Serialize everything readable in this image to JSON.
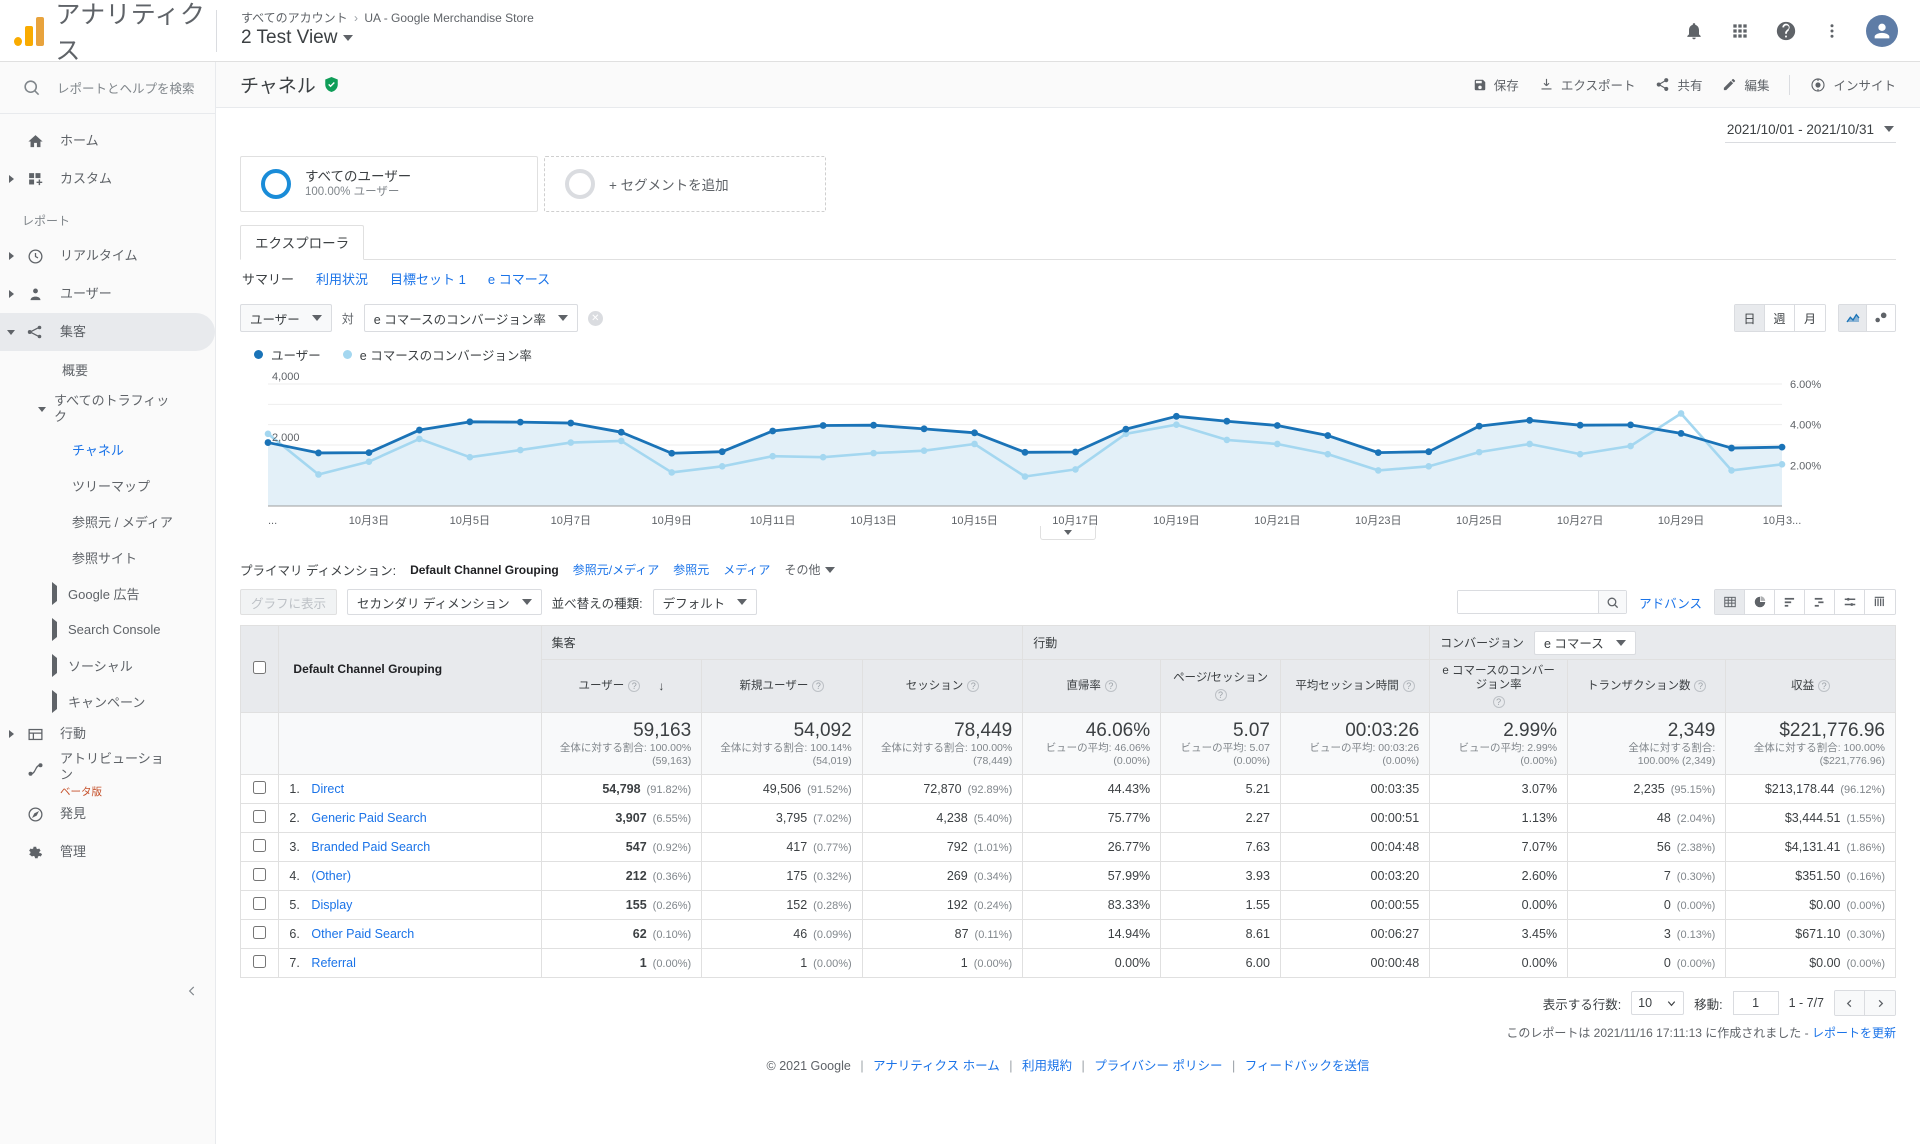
{
  "topbar": {
    "brand": "アナリティクス",
    "breadcrumb_account": "すべてのアカウント",
    "breadcrumb_sep": "›",
    "breadcrumb_property": "UA - Google Merchandise Store",
    "view_name": "2 Test View"
  },
  "sidebar": {
    "search_placeholder": "レポートとヘルプを検索",
    "items": [
      {
        "label": "ホーム",
        "icon": "home-icon"
      },
      {
        "label": "カスタム",
        "icon": "custom-icon"
      }
    ],
    "section_label": "レポート",
    "reports": [
      {
        "label": "リアルタイム",
        "icon": "clock-icon"
      },
      {
        "label": "ユーザー",
        "icon": "person-icon"
      },
      {
        "label": "集客",
        "icon": "acquisition-icon"
      }
    ],
    "acquisition_children": [
      {
        "label": "概要"
      },
      {
        "label": "すべてのトラフィック"
      },
      {
        "label": "チャネル"
      },
      {
        "label": "ツリーマップ"
      },
      {
        "label": "参照元 / メディア"
      },
      {
        "label": "参照サイト"
      },
      {
        "label": "Google 広告"
      },
      {
        "label": "Search Console"
      },
      {
        "label": "ソーシャル"
      },
      {
        "label": "キャンペーン"
      }
    ],
    "bottom": [
      {
        "label": "行動",
        "icon": "behavior-icon"
      },
      {
        "label": "アトリビューション",
        "icon": "attribution-icon",
        "badge": "ベータ版"
      },
      {
        "label": "発見",
        "icon": "discover-icon"
      },
      {
        "label": "管理",
        "icon": "gear-icon"
      }
    ]
  },
  "report": {
    "title": "チャネル",
    "actions": [
      {
        "label": "保存",
        "icon": "save-icon"
      },
      {
        "label": "エクスポート",
        "icon": "export-icon"
      },
      {
        "label": "共有",
        "icon": "share-icon"
      },
      {
        "label": "編集",
        "icon": "edit-icon"
      },
      {
        "label": "インサイト",
        "icon": "insights-icon"
      }
    ],
    "date_range": "2021/10/01 - 2021/10/31"
  },
  "segments": {
    "primary_title": "すべてのユーザー",
    "primary_sub": "100.00% ユーザー",
    "add_label": "+ セグメントを追加"
  },
  "tabs": {
    "explorer": "エクスプローラ",
    "subtabs": [
      {
        "label": "サマリー",
        "active": true
      },
      {
        "label": "利用状況",
        "active": false
      },
      {
        "label": "目標セット 1",
        "active": false
      },
      {
        "label": "e コマース",
        "active": false
      }
    ]
  },
  "metric_controls": {
    "metric1": "ユーザー",
    "vs_label": "対",
    "metric2": "e コマースのコンバージョン率",
    "granularity": [
      {
        "label": "日",
        "active": true
      },
      {
        "label": "週",
        "active": false
      },
      {
        "label": "月",
        "active": false
      }
    ]
  },
  "chart_data": {
    "type": "line",
    "title": "",
    "legend": [
      {
        "name": "ユーザー",
        "color": "#1a73b7"
      },
      {
        "name": "e コマースのコンバージョン率",
        "color": "#a4d7f0"
      }
    ],
    "legend_position": "top-left",
    "grid": true,
    "x": [
      "10月1日",
      "10月2日",
      "10月3日",
      "10月4日",
      "10月5日",
      "10月6日",
      "10月7日",
      "10月8日",
      "10月9日",
      "10月10日",
      "10月11日",
      "10月12日",
      "10月13日",
      "10月14日",
      "10月15日",
      "10月16日",
      "10月17日",
      "10月18日",
      "10月19日",
      "10月20日",
      "10月21日",
      "10月22日",
      "10月23日",
      "10月24日",
      "10月25日",
      "10月26日",
      "10月27日",
      "10月28日",
      "10月29日",
      "10月30日",
      "10月31日"
    ],
    "xtick_labels": [
      "...",
      "10月3日",
      "10月5日",
      "10月7日",
      "10月9日",
      "10月11日",
      "10月13日",
      "10月15日",
      "10月17日",
      "10月19日",
      "10月21日",
      "10月23日",
      "10月25日",
      "10月27日",
      "10月29日",
      "10月3..."
    ],
    "xlabel": "",
    "ylabel": "ユーザー",
    "ylim": [
      0,
      4000
    ],
    "ytick_labels_left": [
      "4,000",
      "2,000"
    ],
    "y2label": "e コマースのコンバージョン率",
    "y2lim": [
      0,
      6
    ],
    "ytick_labels_right": [
      "6.00%",
      "4.00%",
      "2.00%"
    ],
    "series": [
      {
        "name": "ユーザー",
        "color": "#1a73b7",
        "values": [
          2080,
          1740,
          1750,
          2490,
          2760,
          2750,
          2720,
          2420,
          1730,
          1780,
          2460,
          2640,
          2650,
          2530,
          2400,
          1760,
          1770,
          2520,
          2940,
          2780,
          2640,
          2310,
          1750,
          1780,
          2620,
          2810,
          2650,
          2660,
          2380,
          1900,
          1930
        ]
      },
      {
        "name": "e コマースのコンバージョン率",
        "color": "#a4d7f0",
        "values": [
          3.55,
          1.55,
          2.18,
          3.3,
          2.4,
          2.75,
          3.12,
          3.2,
          1.65,
          1.95,
          2.45,
          2.4,
          2.6,
          2.72,
          3.05,
          1.45,
          1.8,
          3.55,
          4.0,
          3.25,
          3.05,
          2.55,
          1.75,
          1.95,
          2.65,
          3.05,
          2.55,
          2.95,
          4.55,
          1.75,
          2.05
        ]
      }
    ]
  },
  "dimension_bar": {
    "label": "プライマリ ディメンション:",
    "current": "Default Channel Grouping",
    "links": [
      "参照元/メディア",
      "参照元",
      "メディア"
    ],
    "more": "その他"
  },
  "toolbar": {
    "plot_rows": "グラフに表示",
    "secondary_dimension": "セカンダリ ディメンション",
    "sort_type_label": "並べ替えの種類:",
    "sort_type_value": "デフォルト",
    "search_value": "",
    "advanced": "アドバンス",
    "view_icons": [
      "table-view-icon",
      "pie-view-icon",
      "bar-view-icon",
      "comparison-view-icon",
      "pivot-view-icon",
      "performance-view-icon"
    ]
  },
  "table": {
    "groups": [
      {
        "label": "集客",
        "span": 3
      },
      {
        "label": "行動",
        "span": 3
      },
      {
        "label": "コンバージョン",
        "span": 3,
        "select": "e コマース"
      }
    ],
    "dimension_header": "Default Channel Grouping",
    "metric_headers": [
      {
        "label": "ユーザー",
        "sorted": true
      },
      {
        "label": "新規ユーザー",
        "sorted": false
      },
      {
        "label": "セッション",
        "sorted": false
      },
      {
        "label": "直帰率",
        "sorted": false
      },
      {
        "label": "ページ/セッション",
        "sorted": false
      },
      {
        "label": "平均セッション時間",
        "sorted": false
      },
      {
        "label": "e コマースのコンバージョン率",
        "sorted": false
      },
      {
        "label": "トランザクション数",
        "sorted": false
      },
      {
        "label": "収益",
        "sorted": false
      }
    ],
    "summary": [
      {
        "value": "59,163",
        "sub1": "全体に対する割合: 100.00%",
        "sub2": "(59,163)"
      },
      {
        "value": "54,092",
        "sub1": "全体に対する割合: 100.14%",
        "sub2": "(54,019)"
      },
      {
        "value": "78,449",
        "sub1": "全体に対する割合: 100.00%",
        "sub2": "(78,449)"
      },
      {
        "value": "46.06%",
        "sub1": "ビューの平均: 46.06%",
        "sub2": "(0.00%)"
      },
      {
        "value": "5.07",
        "sub1": "ビューの平均: 5.07",
        "sub2": "(0.00%)"
      },
      {
        "value": "00:03:26",
        "sub1": "ビューの平均: 00:03:26",
        "sub2": "(0.00%)"
      },
      {
        "value": "2.99%",
        "sub1": "ビューの平均: 2.99%",
        "sub2": "(0.00%)"
      },
      {
        "value": "2,349",
        "sub1": "全体に対する割合:",
        "sub2": "100.00% (2,349)"
      },
      {
        "value": "$221,776.96",
        "sub1": "全体に対する割合: 100.00%",
        "sub2": "($221,776.96)"
      }
    ],
    "rows": [
      {
        "index": "1.",
        "name": "Direct",
        "cells": [
          {
            "v": "54,798",
            "p": "(91.82%)",
            "bold": true
          },
          {
            "v": "49,506",
            "p": "(91.52%)"
          },
          {
            "v": "72,870",
            "p": "(92.89%)"
          },
          {
            "v": "44.43%",
            "p": ""
          },
          {
            "v": "5.21",
            "p": ""
          },
          {
            "v": "00:03:35",
            "p": ""
          },
          {
            "v": "3.07%",
            "p": ""
          },
          {
            "v": "2,235",
            "p": "(95.15%)"
          },
          {
            "v": "$213,178.44",
            "p": "(96.12%)"
          }
        ]
      },
      {
        "index": "2.",
        "name": "Generic Paid Search",
        "cells": [
          {
            "v": "3,907",
            "p": "(6.55%)",
            "bold": true
          },
          {
            "v": "3,795",
            "p": "(7.02%)"
          },
          {
            "v": "4,238",
            "p": "(5.40%)"
          },
          {
            "v": "75.77%",
            "p": ""
          },
          {
            "v": "2.27",
            "p": ""
          },
          {
            "v": "00:00:51",
            "p": ""
          },
          {
            "v": "1.13%",
            "p": ""
          },
          {
            "v": "48",
            "p": "(2.04%)"
          },
          {
            "v": "$3,444.51",
            "p": "(1.55%)"
          }
        ]
      },
      {
        "index": "3.",
        "name": "Branded Paid Search",
        "cells": [
          {
            "v": "547",
            "p": "(0.92%)",
            "bold": true
          },
          {
            "v": "417",
            "p": "(0.77%)"
          },
          {
            "v": "792",
            "p": "(1.01%)"
          },
          {
            "v": "26.77%",
            "p": ""
          },
          {
            "v": "7.63",
            "p": ""
          },
          {
            "v": "00:04:48",
            "p": ""
          },
          {
            "v": "7.07%",
            "p": ""
          },
          {
            "v": "56",
            "p": "(2.38%)"
          },
          {
            "v": "$4,131.41",
            "p": "(1.86%)"
          }
        ]
      },
      {
        "index": "4.",
        "name": "(Other)",
        "cells": [
          {
            "v": "212",
            "p": "(0.36%)",
            "bold": true
          },
          {
            "v": "175",
            "p": "(0.32%)"
          },
          {
            "v": "269",
            "p": "(0.34%)"
          },
          {
            "v": "57.99%",
            "p": ""
          },
          {
            "v": "3.93",
            "p": ""
          },
          {
            "v": "00:03:20",
            "p": ""
          },
          {
            "v": "2.60%",
            "p": ""
          },
          {
            "v": "7",
            "p": "(0.30%)"
          },
          {
            "v": "$351.50",
            "p": "(0.16%)"
          }
        ]
      },
      {
        "index": "5.",
        "name": "Display",
        "cells": [
          {
            "v": "155",
            "p": "(0.26%)",
            "bold": true
          },
          {
            "v": "152",
            "p": "(0.28%)"
          },
          {
            "v": "192",
            "p": "(0.24%)"
          },
          {
            "v": "83.33%",
            "p": ""
          },
          {
            "v": "1.55",
            "p": ""
          },
          {
            "v": "00:00:55",
            "p": ""
          },
          {
            "v": "0.00%",
            "p": ""
          },
          {
            "v": "0",
            "p": "(0.00%)"
          },
          {
            "v": "$0.00",
            "p": "(0.00%)"
          }
        ]
      },
      {
        "index": "6.",
        "name": "Other Paid Search",
        "cells": [
          {
            "v": "62",
            "p": "(0.10%)",
            "bold": true
          },
          {
            "v": "46",
            "p": "(0.09%)"
          },
          {
            "v": "87",
            "p": "(0.11%)"
          },
          {
            "v": "14.94%",
            "p": ""
          },
          {
            "v": "8.61",
            "p": ""
          },
          {
            "v": "00:06:27",
            "p": ""
          },
          {
            "v": "3.45%",
            "p": ""
          },
          {
            "v": "3",
            "p": "(0.13%)"
          },
          {
            "v": "$671.10",
            "p": "(0.30%)"
          }
        ]
      },
      {
        "index": "7.",
        "name": "Referral",
        "cells": [
          {
            "v": "1",
            "p": "(0.00%)",
            "bold": true
          },
          {
            "v": "1",
            "p": "(0.00%)"
          },
          {
            "v": "1",
            "p": "(0.00%)"
          },
          {
            "v": "0.00%",
            "p": ""
          },
          {
            "v": "6.00",
            "p": ""
          },
          {
            "v": "00:00:48",
            "p": ""
          },
          {
            "v": "0.00%",
            "p": ""
          },
          {
            "v": "0",
            "p": "(0.00%)"
          },
          {
            "v": "$0.00",
            "p": "(0.00%)"
          }
        ]
      }
    ]
  },
  "pagination": {
    "rows_label": "表示する行数:",
    "rows_value": "10",
    "goto_label": "移動:",
    "goto_value": "1",
    "range": "1 - 7/7"
  },
  "generated": {
    "text": "このレポートは 2021/11/16 17:11:13 に作成されました -",
    "refresh": "レポートを更新"
  },
  "footer": {
    "copyright": "© 2021 Google",
    "links": [
      "アナリティクス ホーム",
      "利用規約",
      "プライバシー ポリシー",
      "フィードバックを送信"
    ]
  }
}
